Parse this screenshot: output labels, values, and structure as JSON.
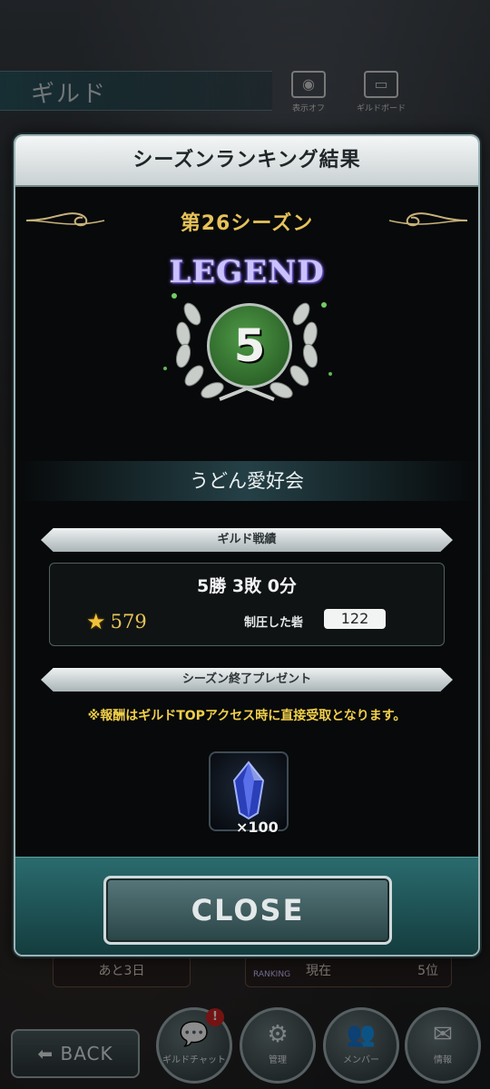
{
  "background": {
    "title": "ギルド",
    "icons": [
      {
        "label": "表示オフ",
        "icon": "eye-icon"
      },
      {
        "label": "ギルドボード",
        "icon": "board-icon"
      }
    ],
    "left_pill": "あと3日",
    "right_pill": {
      "label": "現在",
      "value": "5位",
      "tag": "RANKING"
    },
    "back_label": "BACK",
    "nav": [
      {
        "label": "ギルドチャット",
        "badge": "!"
      },
      {
        "label": "管理"
      },
      {
        "label": "メンバー"
      },
      {
        "label": "情報"
      }
    ]
  },
  "modal": {
    "title": "シーズンランキング結果",
    "season": "第26シーズン",
    "tier": "LEGEND",
    "rank": "5",
    "guild_name": "うどん愛好会",
    "section_record": "ギルド戦績",
    "record": "5勝 3敗 0分",
    "points": "579",
    "forts_label": "制圧した砦",
    "forts_value": "122",
    "section_present": "シーズン終了プレゼント",
    "notice": "※報酬はギルドTOPアクセス時に直接受取となります。",
    "reward": {
      "icon": "crystal-icon",
      "quantity": "×100"
    },
    "close_label": "CLOSE"
  },
  "colors": {
    "accent_gold": "#e6c259",
    "notice_yellow": "#f0cf4a",
    "close_teal": "#2a6b6e",
    "rank_green": "#4f9a47"
  }
}
